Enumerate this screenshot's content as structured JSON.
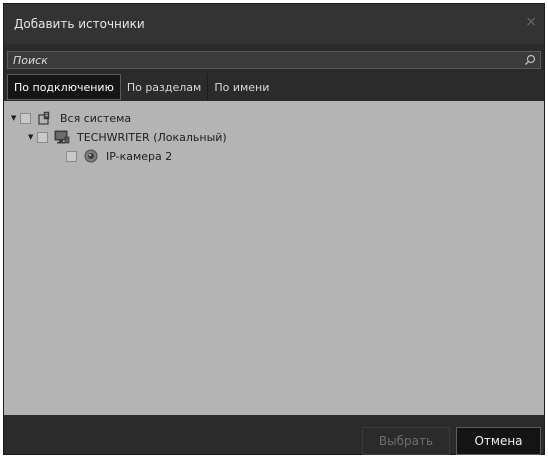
{
  "dialog": {
    "title": "Добавить источники",
    "close_glyph": "×"
  },
  "search": {
    "placeholder": "Поиск",
    "icon": "search-icon"
  },
  "tabs": [
    {
      "label": "По подключению",
      "active": true
    },
    {
      "label": "По разделам",
      "active": false
    },
    {
      "label": "По имени",
      "active": false
    }
  ],
  "tree": [
    {
      "label": "Вся система",
      "level": 0,
      "expanded": true,
      "checked": false,
      "icon": "system-icon"
    },
    {
      "label": "TECHWRITER (Локальный)",
      "level": 1,
      "expanded": true,
      "checked": false,
      "icon": "computer-icon"
    },
    {
      "label": "IP-камера 2",
      "level": 2,
      "expanded": false,
      "checked": false,
      "icon": "camera-icon"
    }
  ],
  "buttons": {
    "select_label": "Выбрать",
    "select_enabled": false,
    "cancel_label": "Отмена"
  },
  "colors": {
    "dialog_bg": "#2b2b2b",
    "content_bg": "#b4b4b4",
    "active_tab_bg": "#151515"
  }
}
